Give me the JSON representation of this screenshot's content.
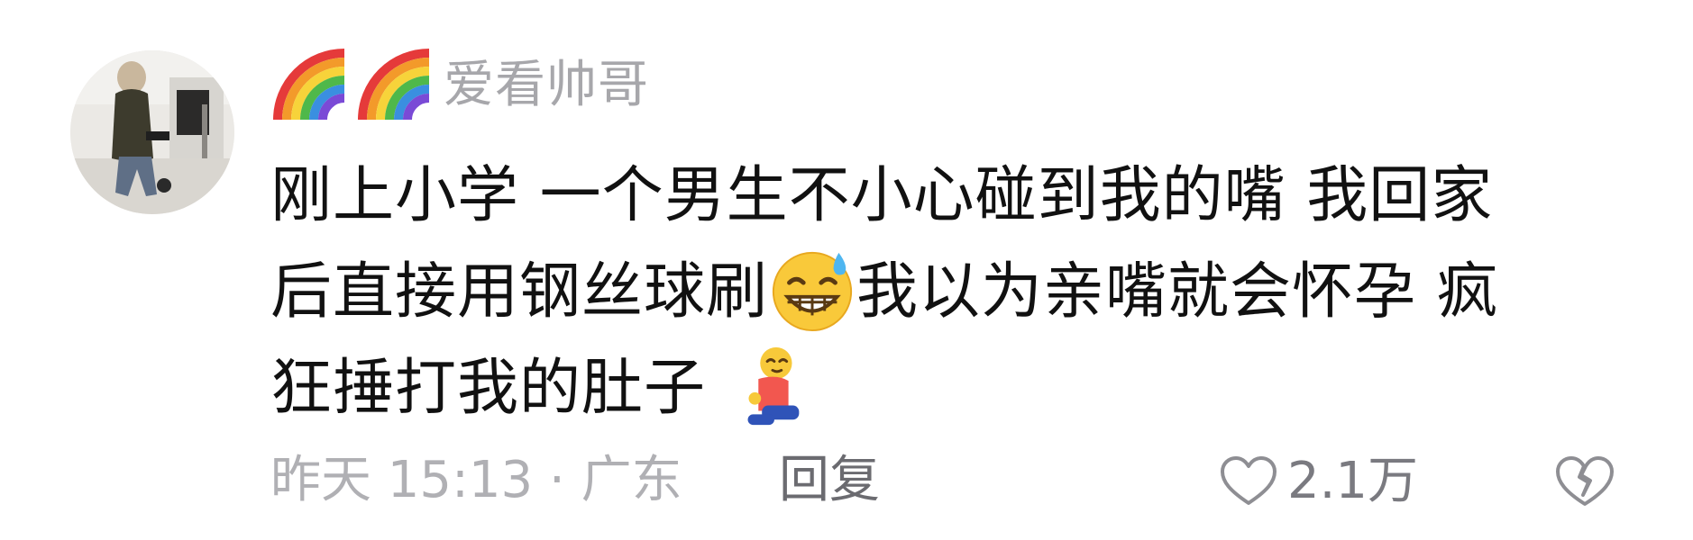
{
  "comment": {
    "author": {
      "name": "爱看帅哥",
      "badges": [
        "rainbow-emoji",
        "rainbow-emoji"
      ]
    },
    "content": {
      "line1": "刚上小学 一个男生不小心碰到我的嘴 我回家",
      "line2_before": "后直接用钢丝球刷",
      "line2_emoji": "grinning-sweat-emoji",
      "line2_after": "我以为亲嘴就会怀孕 疯",
      "line3": "狂捶打我的肚子 ",
      "line3_emoji": "kneeling-person-emoji"
    },
    "footer": {
      "meta": "昨天 15:13 · 广东",
      "reply_label": "回复",
      "like_icon": "heart-outline-icon",
      "like_count": "2.1万",
      "dislike_icon": "broken-heart-outline-icon"
    },
    "colors": {
      "text": "#111111",
      "name": "#a7a7ab",
      "meta": "#b0b0b4",
      "reply": "#6b6b70"
    }
  }
}
